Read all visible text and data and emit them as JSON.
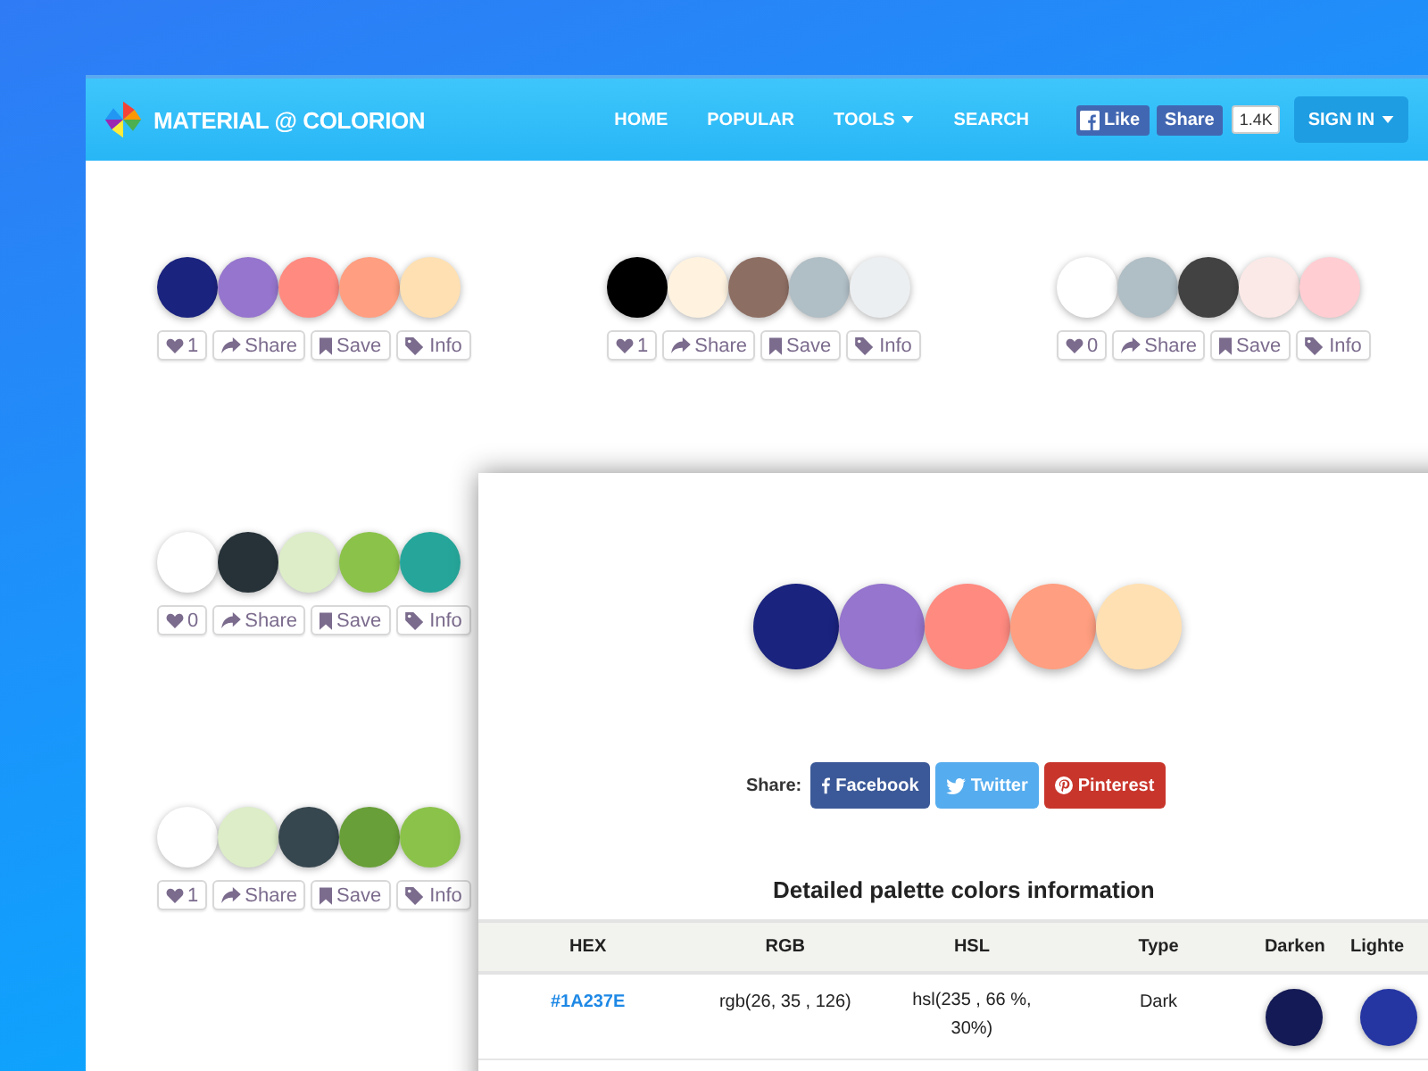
{
  "header": {
    "logo": "MATERIAL @ COLORION",
    "nav": [
      {
        "label": "HOME",
        "dropdown": false
      },
      {
        "label": "POPULAR",
        "dropdown": false
      },
      {
        "label": "TOOLS",
        "dropdown": true
      },
      {
        "label": "SEARCH",
        "dropdown": false
      }
    ],
    "facebook": {
      "like": "Like",
      "share": "Share",
      "count": "1.4K"
    },
    "sign_in": "SIGN IN"
  },
  "palette_rows": [
    [
      {
        "swatches": [
          {
            "color": "#1a237e"
          },
          {
            "color": "#9575cd"
          },
          {
            "color": "#ff8a80"
          },
          {
            "color": "#ff9e80"
          },
          {
            "color": "#ffe0b2"
          }
        ],
        "likes": "1",
        "share": "Share",
        "save": "Save",
        "info": "Info"
      },
      {
        "swatches": [
          {
            "color": "#000000"
          },
          {
            "color": "#fff3e0"
          },
          {
            "color": "#8d6e63"
          },
          {
            "color": "#b0bec5"
          },
          {
            "color": "#eceff1"
          }
        ],
        "likes": "1",
        "share": "Share",
        "save": "Save",
        "info": "Info"
      },
      {
        "swatches": [
          {
            "color": "#ffffff"
          },
          {
            "color": "#b0bec5"
          },
          {
            "color": "#424242"
          },
          {
            "color": "#fbe9e7"
          },
          {
            "color": "#ffcdd2"
          }
        ],
        "likes": "0",
        "share": "Share",
        "save": "Save",
        "info": "Info"
      }
    ],
    [
      {
        "swatches": [
          {
            "color": "#ffffff"
          },
          {
            "color": "#263238"
          },
          {
            "color": "#dcedc8"
          },
          {
            "color": "#8bc34a"
          },
          {
            "color": "#26a69a"
          }
        ],
        "likes": "0",
        "share": "Share",
        "save": "Save",
        "info": "Info"
      }
    ],
    [
      {
        "swatches": [
          {
            "color": "#ffffff"
          },
          {
            "color": "#dcedc8"
          },
          {
            "color": "#37474f"
          },
          {
            "color": "#689f38"
          },
          {
            "color": "#8bc34a"
          }
        ],
        "likes": "1",
        "share": "Share",
        "save": "Save",
        "info": "Info"
      }
    ]
  ],
  "detail": {
    "swatches": [
      {
        "color": "#1a237e"
      },
      {
        "color": "#9575cd"
      },
      {
        "color": "#ff8a80"
      },
      {
        "color": "#ff9e80"
      },
      {
        "color": "#ffe0b2"
      }
    ],
    "share_label": "Share:",
    "share_buttons": [
      {
        "kind": "facebook",
        "label": "Facebook"
      },
      {
        "kind": "twitter",
        "label": "Twitter"
      },
      {
        "kind": "pinterest",
        "label": "Pinterest"
      }
    ],
    "heading": "Detailed palette colors information",
    "table": {
      "columns": [
        "HEX",
        "RGB",
        "HSL",
        "Type",
        "Darken",
        "Lighte"
      ],
      "rows": [
        {
          "hex": "#1A237E",
          "rgb": "rgb(26, 35 , 126)",
          "hsl": "hsl(235 , 66 %, 30%)",
          "type": "Dark",
          "darken": {
            "color": "#141a55"
          },
          "lighten": {
            "color": "#2536a3"
          }
        }
      ]
    }
  }
}
